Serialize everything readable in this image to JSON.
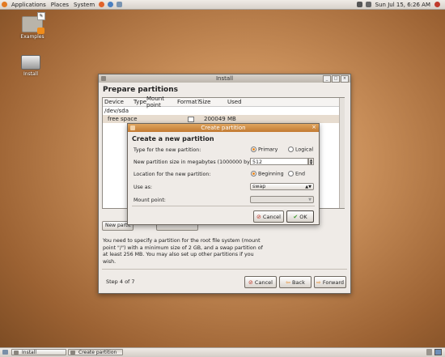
{
  "top_panel": {
    "menus": [
      "Applications",
      "Places",
      "System"
    ],
    "clock": "Sun Jul 15,  6:26 AM"
  },
  "desktop": {
    "icons": [
      {
        "label": "Examples"
      },
      {
        "label": "Install"
      }
    ]
  },
  "install_window": {
    "title": "Install",
    "heading": "Prepare partitions",
    "table": {
      "columns": [
        "Device",
        "Type",
        "Mount point",
        "Format?",
        "Size",
        "Used"
      ],
      "rows": [
        {
          "device": "/dev/sda",
          "type": "",
          "mount": "",
          "format": "",
          "size": "",
          "used": ""
        },
        {
          "device": "free space",
          "type": "",
          "mount": "",
          "format": "checkbox",
          "size": "200049 MB",
          "used": ""
        }
      ]
    },
    "new_partition_label": "New partit",
    "info_text": "You need to specify a partition for the root file system (mount point \"/\") with a minimum size of 2 GB, and a swap partition of at least 256 MB. You may also set up other partitions if you wish.",
    "step": "Step 4 of 7",
    "buttons": {
      "cancel": "Cancel",
      "back": "Back",
      "forward": "Forward"
    }
  },
  "create_dialog": {
    "title": "Create partition",
    "heading": "Create a new partition",
    "type_label": "Type for the new partition:",
    "type_primary": "Primary",
    "type_logical": "Logical",
    "size_label": "New partition size in megabytes (1000000 bytes):",
    "size_value": "512",
    "location_label": "Location for the new partition:",
    "location_beginning": "Beginning",
    "location_end": "End",
    "use_as_label": "Use as:",
    "use_as_value": "swap",
    "mount_label": "Mount point:",
    "mount_value": "",
    "buttons": {
      "cancel": "Cancel",
      "ok": "OK"
    }
  },
  "taskbar": {
    "tasks": [
      "Install",
      "Create partition"
    ]
  },
  "colors": {
    "accent": "#e8861e",
    "titlebar_active": "#c27a32"
  }
}
